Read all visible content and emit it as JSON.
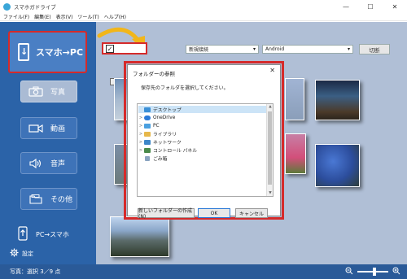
{
  "window": {
    "title": "スマホガドライブ",
    "controls": [
      "—",
      "☐",
      "✕"
    ]
  },
  "menu": [
    "ファイル(F)",
    "編集(E)",
    "表示(V)",
    "ツール(T)",
    "ヘルプ(H)"
  ],
  "sidebar": {
    "transfer_button": "スマホ→PC",
    "categories": [
      {
        "label": "写真",
        "icon": "camera-icon",
        "active": true
      },
      {
        "label": "動画",
        "icon": "video-camera-icon",
        "active": false
      },
      {
        "label": "音声",
        "icon": "speaker-icon",
        "active": false
      },
      {
        "label": "その他",
        "icon": "folder-icon",
        "active": false
      }
    ],
    "pc_to_phone": "PC→スマホ",
    "settings": "設定"
  },
  "toolbar": {
    "checkbox_mark": "✓",
    "connection_select": "新規接続",
    "device_select": "Android",
    "disconnect_button": "切断"
  },
  "status": {
    "selection_text": "写真：選択 3／9 点",
    "zoom_out": "−",
    "zoom_in": "+",
    "zoom_level": 0.55
  },
  "dialog": {
    "title": "フォルダーの参照",
    "close": "✕",
    "message": "保存先のフォルダを選択してください。",
    "tree": [
      {
        "label": "デスクトップ",
        "icon": "desktop-icon",
        "selected": true,
        "expander": "",
        "color": "#3a8fd6"
      },
      {
        "label": "OneDrive",
        "icon": "cloud-icon",
        "selected": false,
        "expander": ">",
        "color": "#2b7bd8"
      },
      {
        "label": "PC",
        "icon": "computer-icon",
        "selected": false,
        "expander": ">",
        "color": "#4aa0e0"
      },
      {
        "label": "ライブラリ",
        "icon": "library-icon",
        "selected": false,
        "expander": ">",
        "color": "#e7b84a"
      },
      {
        "label": "ネットワーク",
        "icon": "network-icon",
        "selected": false,
        "expander": ">",
        "color": "#3d86c8"
      },
      {
        "label": "コントロール パネル",
        "icon": "control-panel-icon",
        "selected": false,
        "expander": ">",
        "color": "#4a8a4a"
      },
      {
        "label": "ごみ箱",
        "icon": "trash-icon",
        "selected": false,
        "expander": "",
        "color": "#8aa4c0"
      }
    ],
    "buttons": {
      "new_folder": "新しいフォルダーの作成(N)",
      "ok": "OK",
      "cancel": "キャンセル"
    }
  },
  "colors": {
    "sidebar": "#2b63a8",
    "main": "#b0bfd6",
    "highlight": "#d52a2a",
    "arrow": "#f2b619"
  }
}
